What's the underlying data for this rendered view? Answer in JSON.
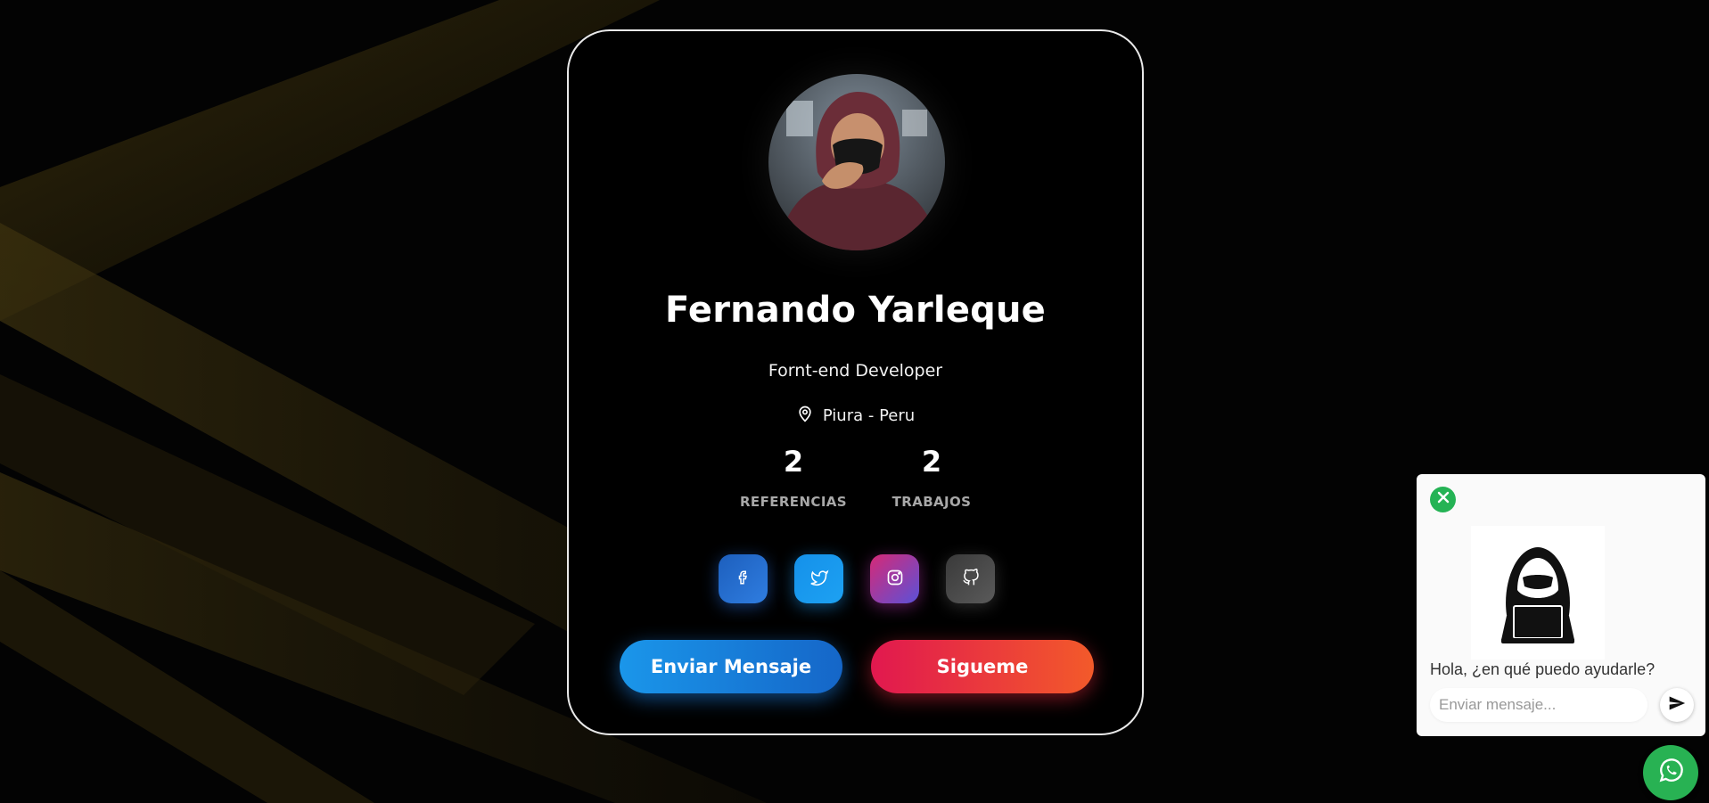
{
  "profile": {
    "name": "Fernando Yarleque",
    "role": "Fornt-end Developer",
    "location": "Piura - Peru",
    "avatar_alt": "hooded-person-photo"
  },
  "stats": [
    {
      "value": "2",
      "label": "REFERENCIAS"
    },
    {
      "value": "2",
      "label": "TRABAJOS"
    }
  ],
  "social": [
    {
      "icon": "facebook-icon",
      "color_from": "#1d5fbd",
      "color_to": "#2f7de0"
    },
    {
      "icon": "twitter-icon",
      "color_from": "#1591ea",
      "color_to": "#1da1f2"
    },
    {
      "icon": "instagram-icon",
      "color_from": "#d62976",
      "color_to": "#5b51d8"
    },
    {
      "icon": "github-icon",
      "color_from": "#3a3a3a",
      "color_to": "#5a5a5a"
    }
  ],
  "actions": {
    "message_label": "Enviar Mensaje",
    "follow_label": "Sigueme"
  },
  "chat": {
    "question": "Hola, ¿en qué puedo ayudarle?",
    "placeholder": "Enviar mensaje...",
    "accent": "#25b355"
  },
  "colors": {
    "background": "#030303",
    "card_border": "#e9e9e9",
    "beam": "#4a3a10"
  }
}
